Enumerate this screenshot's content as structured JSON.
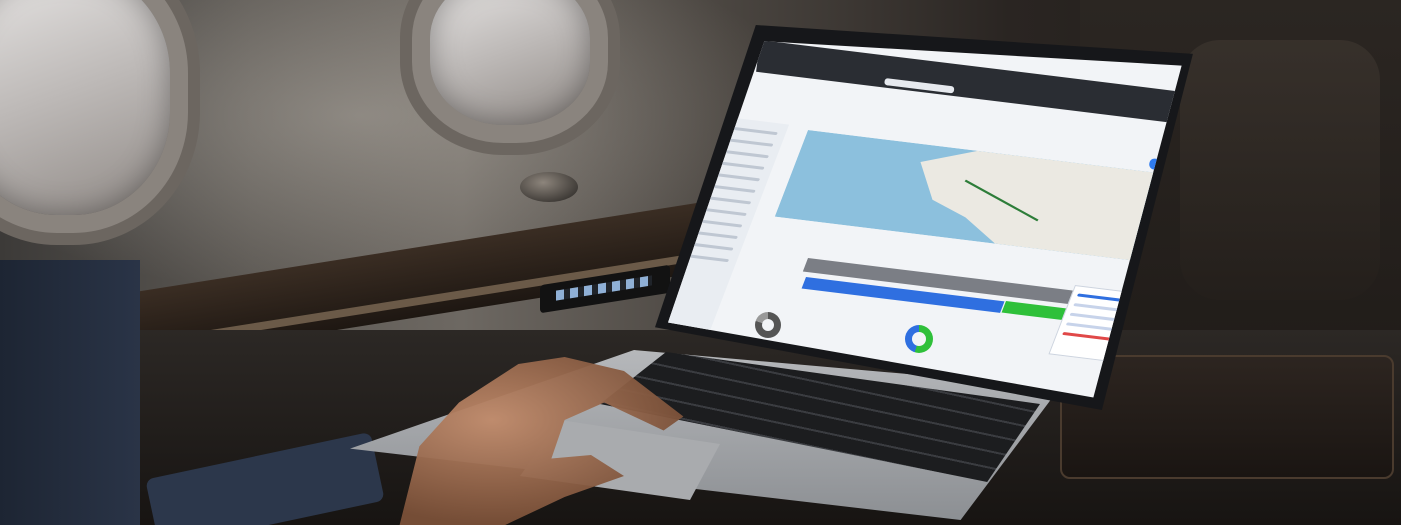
{
  "scene": {
    "colors": {
      "cabin_wall": "#5c5853",
      "window_glass": "#d4d1cf",
      "table_surface": "#2c2825",
      "laptop_body": "#b6b8bb",
      "screen_background": "#f2f4f7",
      "accent_blue": "#2f6fe0",
      "accent_green": "#2fc03a",
      "accent_grey": "#7b7e85",
      "accent_red": "#e04848",
      "map_water": "#8cc0dd",
      "map_land": "#ebe9e2"
    }
  }
}
